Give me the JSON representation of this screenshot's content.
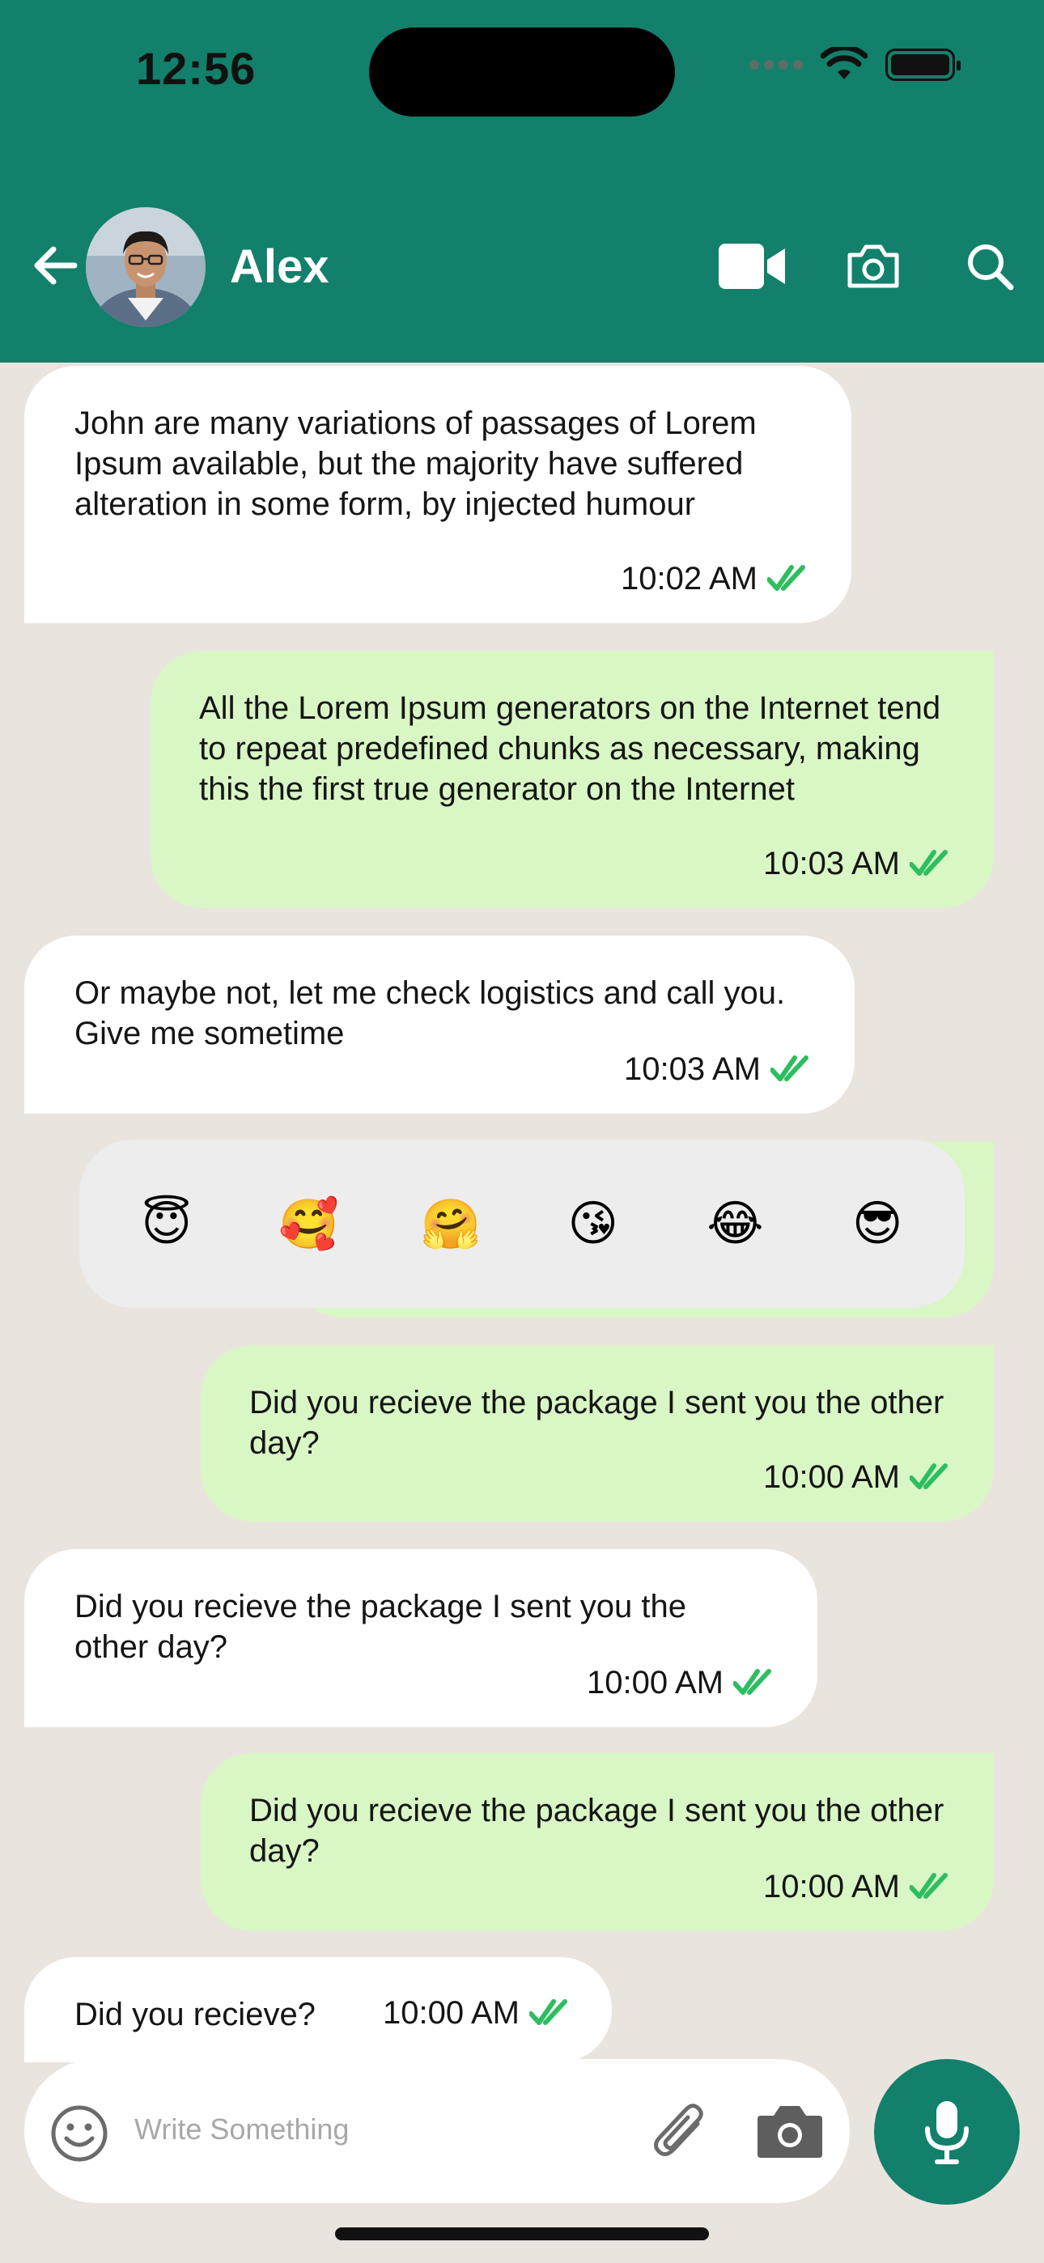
{
  "status_bar": {
    "time": "12:56"
  },
  "header": {
    "contact_name": "Alex"
  },
  "messages": [
    {
      "direction": "in",
      "text": "John are many variations of passages of Lorem Ipsum available, but the majority have suffered alteration in some form, by injected humour",
      "time": "10:02 AM"
    },
    {
      "direction": "out",
      "text": "All the Lorem Ipsum generators on the Internet tend to repeat predefined chunks as necessary, making this the first true generator on the Internet",
      "time": "10:03 AM"
    },
    {
      "direction": "in",
      "text": "Or maybe not, let me check logistics and call you. Give me sometime",
      "time": "10:03 AM"
    },
    {
      "direction": "out",
      "text": "Did you recieve the package I sent you the other day?",
      "time": "10:00 AM"
    },
    {
      "direction": "in",
      "text": "Did you recieve the package I sent you the other day?",
      "time": "10:00 AM"
    },
    {
      "direction": "out",
      "text": "Did you recieve the package I sent you the other day?",
      "time": "10:00 AM"
    },
    {
      "direction": "in",
      "text": "Did you recieve?",
      "time": "10:00 AM"
    }
  ],
  "reactions": [
    "😇",
    "🥰",
    "🤗",
    "😘",
    "😂",
    "😎"
  ],
  "composer": {
    "placeholder": "Write Something"
  },
  "colors": {
    "brand": "#12806A",
    "outgoing_bubble": "#D9F6C5",
    "incoming_bubble": "#FFFFFF",
    "read_check": "#2DBE60",
    "background": "#EAE4DE"
  }
}
